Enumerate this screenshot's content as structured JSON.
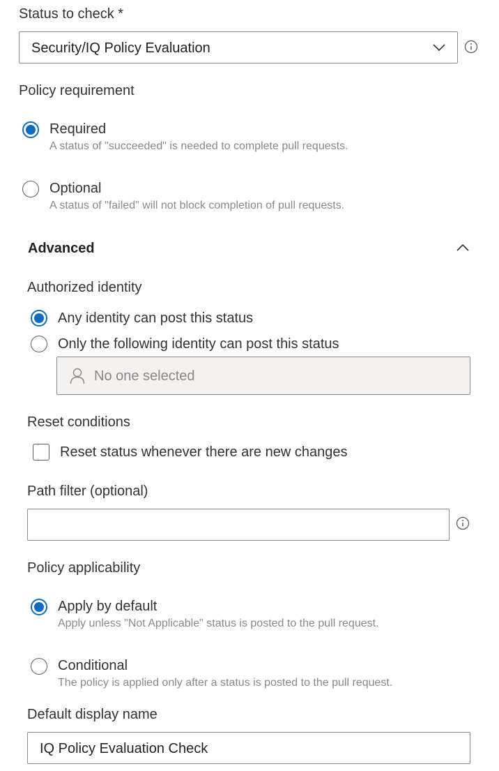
{
  "status_check": {
    "label": "Status to check *",
    "selected_value": "Security/IQ Policy Evaluation"
  },
  "policy_requirement": {
    "label": "Policy requirement",
    "options": [
      {
        "label": "Required",
        "description": "A status of \"succeeded\" is needed to complete pull requests.",
        "checked": true
      },
      {
        "label": "Optional",
        "description": "A status of \"failed\" will not block completion of pull requests.",
        "checked": false
      }
    ]
  },
  "advanced": {
    "title": "Advanced",
    "authorized_identity": {
      "label": "Authorized identity",
      "options": [
        {
          "label": "Any identity can post this status",
          "checked": true
        },
        {
          "label": "Only the following identity can post this status",
          "checked": false
        }
      ],
      "identity_placeholder": "No one selected"
    },
    "reset_conditions": {
      "label": "Reset conditions",
      "checkbox_label": "Reset status whenever there are new changes",
      "checked": false
    },
    "path_filter": {
      "label": "Path filter (optional)",
      "value": ""
    },
    "policy_applicability": {
      "label": "Policy applicability",
      "options": [
        {
          "label": "Apply by default",
          "description": "Apply unless \"Not Applicable\" status is posted to the pull request.",
          "checked": true
        },
        {
          "label": "Conditional",
          "description": "The policy is applied only after a status is posted to the pull request.",
          "checked": false
        }
      ]
    },
    "display_name": {
      "label": "Default display name",
      "value": "IQ Policy Evaluation Check"
    }
  },
  "colors": {
    "accent": "#0f6cbd",
    "border": "#8a8886",
    "disabled_fill": "#f3f2f1"
  }
}
